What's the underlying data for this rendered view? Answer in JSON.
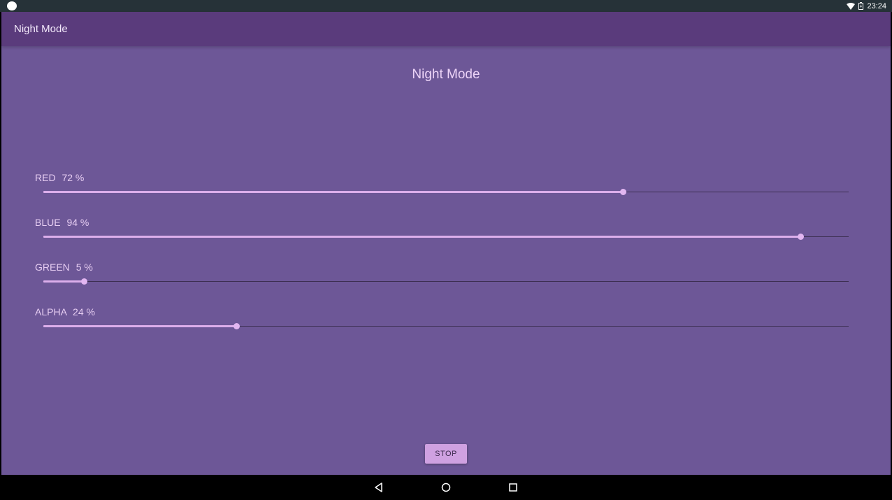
{
  "status_bar": {
    "time": "23:24",
    "icons": [
      "notification-dot-icon",
      "wifi-icon",
      "battery-icon"
    ]
  },
  "app_bar": {
    "title": "Night Mode",
    "color": "#5a3b7c"
  },
  "main": {
    "title": "Night Mode",
    "background": "#6d5797",
    "sliders": [
      {
        "label": "RED",
        "value_text": "72 %",
        "value": 72
      },
      {
        "label": "BLUE",
        "value_text": "94 %",
        "value": 94
      },
      {
        "label": "GREEN",
        "value_text": "5 %",
        "value": 5
      },
      {
        "label": "ALPHA",
        "value_text": "24 %",
        "value": 24
      }
    ],
    "stop_label": "STOP"
  },
  "nav_bar": {
    "icons": [
      "back-icon",
      "home-icon",
      "recents-icon"
    ]
  }
}
